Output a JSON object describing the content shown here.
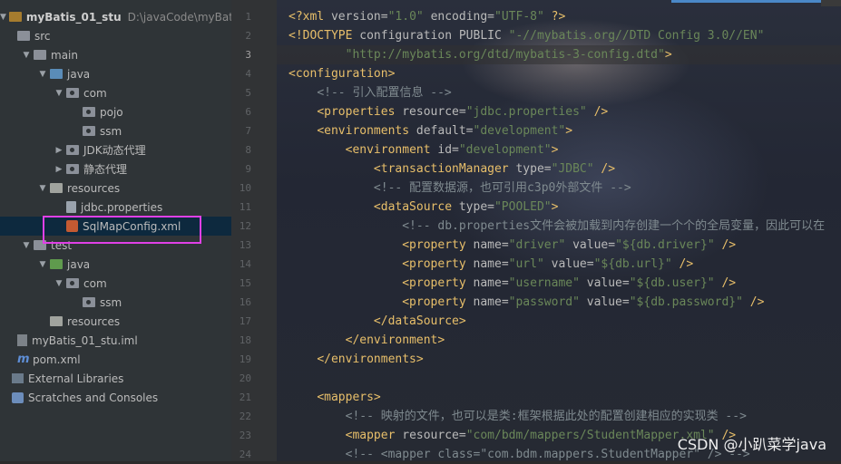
{
  "project_tree": {
    "root": {
      "name": "myBatis_01_stu",
      "path": "D:\\javaCode\\myBatisAll\\m"
    },
    "items": [
      {
        "label": "src",
        "indent": 0,
        "arrow": "",
        "icon": "folder"
      },
      {
        "label": "main",
        "indent": 1,
        "arrow": "▼",
        "icon": "folder"
      },
      {
        "label": "java",
        "indent": 2,
        "arrow": "▼",
        "icon": "folder-src"
      },
      {
        "label": "com",
        "indent": 3,
        "arrow": "▼",
        "icon": "package"
      },
      {
        "label": "pojo",
        "indent": 4,
        "arrow": "",
        "icon": "package"
      },
      {
        "label": "ssm",
        "indent": 4,
        "arrow": "",
        "icon": "package"
      },
      {
        "label": "JDK动态代理",
        "indent": 3,
        "arrow": "▶",
        "icon": "package"
      },
      {
        "label": "静态代理",
        "indent": 3,
        "arrow": "▶",
        "icon": "package"
      },
      {
        "label": "resources",
        "indent": 2,
        "arrow": "▼",
        "icon": "folder-res"
      },
      {
        "label": "jdbc.properties",
        "indent": 3,
        "arrow": "",
        "icon": "file"
      },
      {
        "label": "SqlMapConfig.xml",
        "indent": 3,
        "arrow": "",
        "icon": "xml"
      },
      {
        "label": "test",
        "indent": 1,
        "arrow": "▼",
        "icon": "folder"
      },
      {
        "label": "java",
        "indent": 2,
        "arrow": "▼",
        "icon": "folder-test"
      },
      {
        "label": "com",
        "indent": 3,
        "arrow": "▼",
        "icon": "package"
      },
      {
        "label": "ssm",
        "indent": 4,
        "arrow": "",
        "icon": "package"
      },
      {
        "label": "resources",
        "indent": 2,
        "arrow": "",
        "icon": "folder-res"
      },
      {
        "label": "myBatis_01_stu.iml",
        "indent": 0,
        "arrow": "",
        "icon": "iml"
      },
      {
        "label": "pom.xml",
        "indent": 0,
        "arrow": "",
        "icon": "maven"
      },
      {
        "label": "External Libraries",
        "indent": -1,
        "arrow": "",
        "icon": "library"
      },
      {
        "label": "Scratches and Consoles",
        "indent": -1,
        "arrow": "",
        "icon": "scratch"
      }
    ],
    "selected_index": 10
  },
  "editor": {
    "current_line": 3,
    "lines": [
      {
        "n": "1",
        "tokens": [
          [
            "decl",
            "<?xml "
          ],
          [
            "attr",
            "version="
          ],
          [
            "val",
            "\"1.0\" "
          ],
          [
            "attr",
            "encoding="
          ],
          [
            "val",
            "\"UTF-8\" "
          ],
          [
            "decl",
            "?>"
          ]
        ]
      },
      {
        "n": "2",
        "tokens": [
          [
            "decl",
            "<!DOCTYPE "
          ],
          [
            "attr",
            "configuration PUBLIC "
          ],
          [
            "val",
            "\"-//mybatis.org//DTD Config 3.0//EN\""
          ]
        ]
      },
      {
        "n": "3",
        "tokens": [
          [
            "plain",
            "        "
          ],
          [
            "url",
            "\"http://mybatis.org/dtd/mybatis-3-config.dtd\""
          ],
          [
            "tag",
            ">"
          ]
        ]
      },
      {
        "n": "4",
        "tokens": [
          [
            "tag",
            "<configuration>"
          ]
        ]
      },
      {
        "n": "5",
        "tokens": [
          [
            "plain",
            "    "
          ],
          [
            "com",
            "<!-- 引入配置信息 -->"
          ]
        ]
      },
      {
        "n": "6",
        "tokens": [
          [
            "plain",
            "    "
          ],
          [
            "tag",
            "<properties "
          ],
          [
            "attr",
            "resource="
          ],
          [
            "val",
            "\"jdbc.properties\" "
          ],
          [
            "tag",
            "/>"
          ]
        ]
      },
      {
        "n": "7",
        "tokens": [
          [
            "plain",
            "    "
          ],
          [
            "tag",
            "<environments "
          ],
          [
            "attr",
            "default="
          ],
          [
            "val",
            "\"development\""
          ],
          [
            "tag",
            ">"
          ]
        ]
      },
      {
        "n": "8",
        "tokens": [
          [
            "plain",
            "        "
          ],
          [
            "tag",
            "<environment "
          ],
          [
            "attr",
            "id="
          ],
          [
            "val",
            "\"development\""
          ],
          [
            "tag",
            ">"
          ]
        ]
      },
      {
        "n": "9",
        "tokens": [
          [
            "plain",
            "            "
          ],
          [
            "tag",
            "<transactionManager "
          ],
          [
            "attr",
            "type="
          ],
          [
            "val",
            "\"JDBC\" "
          ],
          [
            "tag",
            "/>"
          ]
        ]
      },
      {
        "n": "10",
        "tokens": [
          [
            "plain",
            "            "
          ],
          [
            "com",
            "<!-- 配置数据源，也可引用c3p0外部文件 -->"
          ]
        ]
      },
      {
        "n": "11",
        "tokens": [
          [
            "plain",
            "            "
          ],
          [
            "tag",
            "<dataSource "
          ],
          [
            "attr",
            "type="
          ],
          [
            "val",
            "\"POOLED\""
          ],
          [
            "tag",
            ">"
          ]
        ]
      },
      {
        "n": "12",
        "tokens": [
          [
            "plain",
            "                "
          ],
          [
            "com",
            "<!-- db.properties文件会被加载到内存创建一个个的全局变量，因此可以在"
          ]
        ]
      },
      {
        "n": "13",
        "tokens": [
          [
            "plain",
            "                "
          ],
          [
            "tag",
            "<property "
          ],
          [
            "attr",
            "name="
          ],
          [
            "val",
            "\"driver\" "
          ],
          [
            "attr",
            "value="
          ],
          [
            "val",
            "\"${db.driver}\" "
          ],
          [
            "tag",
            "/>"
          ]
        ]
      },
      {
        "n": "14",
        "tokens": [
          [
            "plain",
            "                "
          ],
          [
            "tag",
            "<property "
          ],
          [
            "attr",
            "name="
          ],
          [
            "val",
            "\"url\" "
          ],
          [
            "attr",
            "value="
          ],
          [
            "val",
            "\"${db.url}\" "
          ],
          [
            "tag",
            "/>"
          ]
        ]
      },
      {
        "n": "15",
        "tokens": [
          [
            "plain",
            "                "
          ],
          [
            "tag",
            "<property "
          ],
          [
            "attr",
            "name="
          ],
          [
            "val",
            "\"username\" "
          ],
          [
            "attr",
            "value="
          ],
          [
            "val",
            "\"${db.user}\" "
          ],
          [
            "tag",
            "/>"
          ]
        ]
      },
      {
        "n": "16",
        "tokens": [
          [
            "plain",
            "                "
          ],
          [
            "tag",
            "<property "
          ],
          [
            "attr",
            "name="
          ],
          [
            "val",
            "\"password\" "
          ],
          [
            "attr",
            "value="
          ],
          [
            "val",
            "\"${db.password}\" "
          ],
          [
            "tag",
            "/>"
          ]
        ]
      },
      {
        "n": "17",
        "tokens": [
          [
            "plain",
            "            "
          ],
          [
            "tag",
            "</dataSource>"
          ]
        ]
      },
      {
        "n": "18",
        "tokens": [
          [
            "plain",
            "        "
          ],
          [
            "tag",
            "</environment>"
          ]
        ]
      },
      {
        "n": "19",
        "tokens": [
          [
            "plain",
            "    "
          ],
          [
            "tag",
            "</environments>"
          ]
        ]
      },
      {
        "n": "20",
        "tokens": []
      },
      {
        "n": "21",
        "tokens": [
          [
            "plain",
            "    "
          ],
          [
            "tag",
            "<mappers>"
          ]
        ]
      },
      {
        "n": "22",
        "tokens": [
          [
            "plain",
            "        "
          ],
          [
            "com",
            "<!-- 映射的文件，也可以是类:框架根据此处的配置创建相应的实现类 -->"
          ]
        ]
      },
      {
        "n": "23",
        "tokens": [
          [
            "plain",
            "        "
          ],
          [
            "tag",
            "<mapper "
          ],
          [
            "attr",
            "resource="
          ],
          [
            "val",
            "\"com/bdm/mappers/StudentMapper.xml\" "
          ],
          [
            "tag",
            "/>"
          ]
        ]
      },
      {
        "n": "24",
        "tokens": [
          [
            "plain",
            "        "
          ],
          [
            "com",
            "<!-- <mapper class=\"com.bdm.mappers.StudentMapper\" /> -->"
          ]
        ]
      }
    ]
  },
  "watermark": "CSDN @小趴菜学java",
  "colors": {
    "highlight_box": "#e040e6",
    "selection": "#0d293e"
  }
}
